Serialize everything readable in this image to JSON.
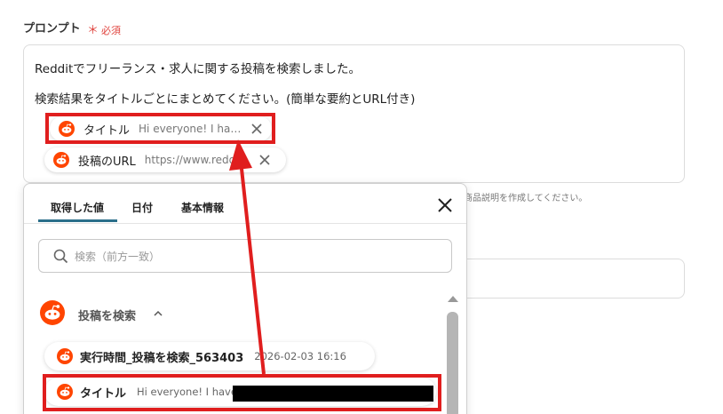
{
  "field": {
    "label": "プロンプト",
    "required_mark": "＊",
    "required_text": "必須"
  },
  "prompt": {
    "line1": "Redditでフリーランス・求人に関する投稿を検索しました。",
    "line2": "検索結果をタイトルごとにまとめてください。(簡単な要約とURL付き)",
    "chips": [
      {
        "label": "タイトル",
        "value": "Hi everyone! I hav...",
        "icon": "reddit-icon"
      },
      {
        "label": "投稿のURL",
        "value": "https://www.reddi...",
        "icon": "reddit-icon"
      }
    ]
  },
  "hint_text": "商品説明を作成してください。",
  "popup": {
    "tabs": [
      "取得した値",
      "日付",
      "基本情報"
    ],
    "active_tab": 0,
    "search_placeholder": "検索（前方一致）",
    "group": {
      "title": "投稿を検索",
      "expanded": true
    },
    "items": [
      {
        "label": "実行時間_投稿を検索_563403",
        "value": "2026-02-03 16:16"
      },
      {
        "label": "タイトル",
        "value": "Hi everyone! I have"
      }
    ]
  },
  "colors": {
    "accent": "#2b6f8a",
    "highlight": "#e01e1e",
    "required": "#e0443f",
    "reddit": "#ff4500"
  }
}
